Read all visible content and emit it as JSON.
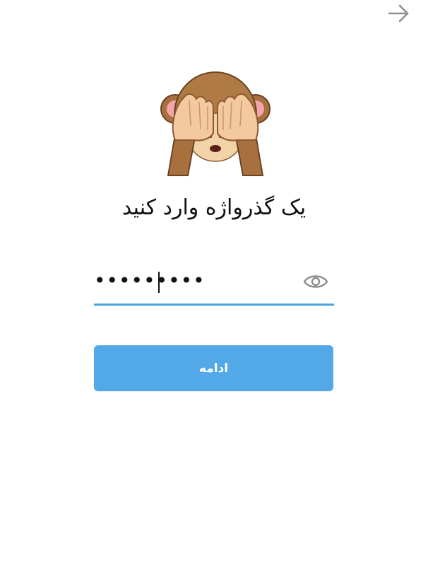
{
  "header": {
    "back_icon": "arrow-right-icon"
  },
  "illustration": {
    "icon": "see-no-evil-monkey-icon"
  },
  "title": "یک گذرواژه وارد کنید",
  "password_field": {
    "value": "•••••••••",
    "visibility_icon": "eye-icon"
  },
  "continue_button": {
    "label": "ادامه"
  },
  "colors": {
    "accent": "#53a8e8",
    "underline": "#4aa3df",
    "icon_gray": "#8e8e93"
  }
}
